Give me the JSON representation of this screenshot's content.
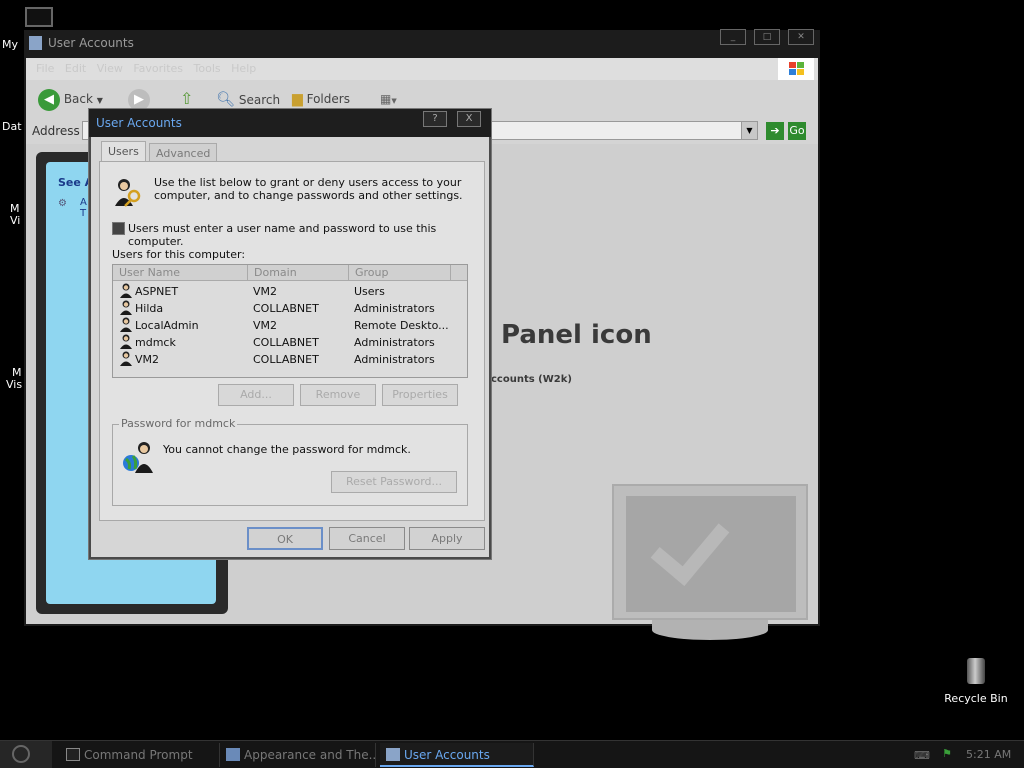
{
  "desktop": {
    "left_labels": [
      "My",
      "Dat",
      "M",
      "Vi",
      "M",
      "Vis"
    ],
    "recycle_bin": "Recycle Bin"
  },
  "explorer": {
    "title": "User Accounts",
    "menu": [
      "File",
      "Edit",
      "View",
      "Favorites",
      "Tools",
      "Help"
    ],
    "toolbar": {
      "back": "Back",
      "search": "Search",
      "folders": "Folders"
    },
    "address_label": "Address",
    "go": "Go",
    "left_pane": {
      "see_also": "See A",
      "item_line1": "A",
      "item_line2": "T"
    },
    "heading": "Panel icon",
    "subtext": "ccounts (W2k)"
  },
  "dialog": {
    "title": "User Accounts",
    "title_buttons": {
      "help": "?",
      "close": "X"
    },
    "tabs": [
      "Users",
      "Advanced"
    ],
    "intro": "Use the list below to grant or deny users access to your computer, and to change passwords and other settings.",
    "checkbox_label": "Users must enter a user name and password to use this computer.",
    "users_label": "Users for this computer:",
    "columns": [
      "User Name",
      "Domain",
      "Group"
    ],
    "users": [
      {
        "name": "ASPNET",
        "domain": "VM2",
        "group": "Users"
      },
      {
        "name": "Hilda",
        "domain": "COLLABNET",
        "group": "Administrators"
      },
      {
        "name": "LocalAdmin",
        "domain": "VM2",
        "group": "Remote Deskto..."
      },
      {
        "name": "mdmck",
        "domain": "COLLABNET",
        "group": "Administrators"
      },
      {
        "name": "VM2",
        "domain": "COLLABNET",
        "group": "Administrators"
      }
    ],
    "buttons": {
      "add": "Add...",
      "remove": "Remove",
      "properties": "Properties"
    },
    "password_group": {
      "legend": "Password for mdmck",
      "text": "You cannot change the password for mdmck.",
      "reset": "Reset Password..."
    },
    "footer": {
      "ok": "OK",
      "cancel": "Cancel",
      "apply": "Apply"
    }
  },
  "taskbar": {
    "tasks": [
      "Command Prompt",
      "Appearance and The...",
      "User Accounts"
    ],
    "clock": "5:21 AM"
  },
  "colors": {
    "accent": "#6aa8f0",
    "desktop": "#000000"
  }
}
